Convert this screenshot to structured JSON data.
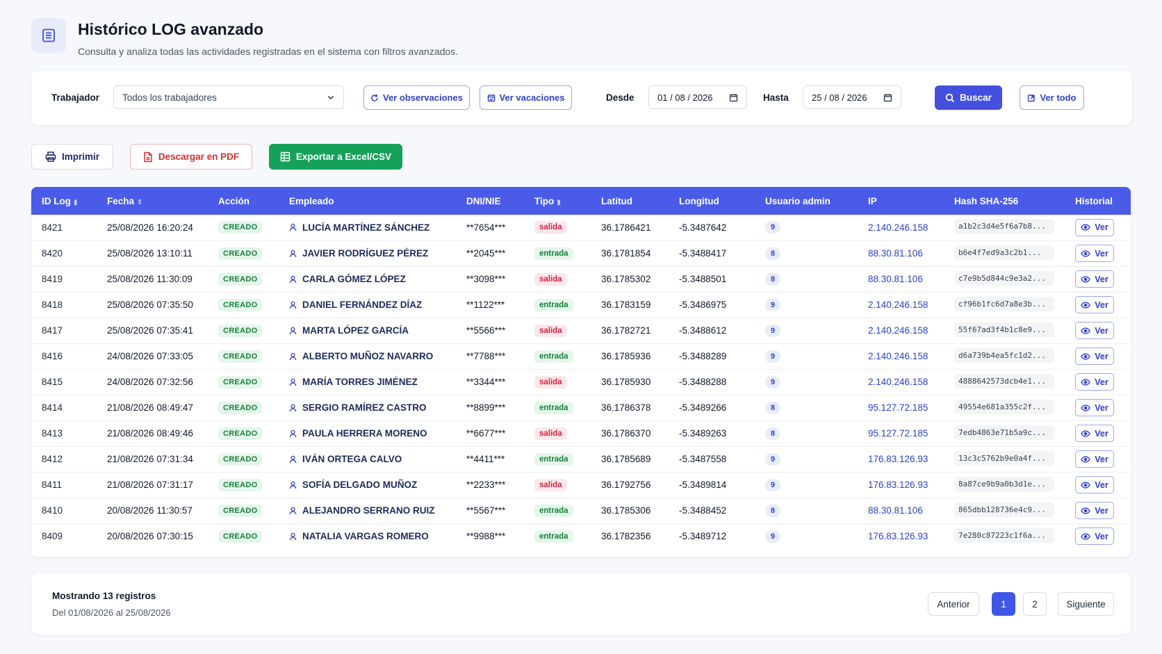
{
  "header": {
    "title": "Histórico LOG avanzado",
    "subtitle": "Consulta y analiza todas las actividades registradas en el sistema con filtros avanzados."
  },
  "filters": {
    "worker_label": "Trabajador",
    "worker_value": "Todos los trabajadores",
    "ver_observaciones": "Ver observaciones",
    "ver_vacaciones": "Ver vacaciones",
    "desde_label": "Desde",
    "desde_value": "01 / 08 / 2026",
    "hasta_label": "Hasta",
    "hasta_value": "25 / 08 / 2026",
    "buscar": "Buscar",
    "ver_todo": "Ver todo"
  },
  "actions": {
    "imprimir": "Imprimir",
    "pdf": "Descargar en PDF",
    "excel": "Exportar a Excel/CSV"
  },
  "table": {
    "columns": [
      "ID Log",
      "Fecha",
      "Acción",
      "Empleado",
      "DNI/NIE",
      "Tipo",
      "Latitud",
      "Longitud",
      "Usuario admin",
      "IP",
      "Hash SHA-256",
      "Historial"
    ],
    "ver_label": "Ver",
    "rows": [
      {
        "id": "8421",
        "fecha": "25/08/2026 16:20:24",
        "accion": "CREADO",
        "empleado": "LUCÍA MARTÍNEZ SÁNCHEZ",
        "dni": "**7654***",
        "tipo": "salida",
        "lat": "36.1786421",
        "lon": "-5.3487642",
        "admin": "9",
        "ip": "2.140.246.158",
        "hash": "a1b2c3d4e5f6a7b8..."
      },
      {
        "id": "8420",
        "fecha": "25/08/2026 13:10:11",
        "accion": "CREADO",
        "empleado": "JAVIER RODRÍGUEZ PÉREZ",
        "dni": "**2045***",
        "tipo": "entrada",
        "lat": "36.1781854",
        "lon": "-5.3488417",
        "admin": "8",
        "ip": "88.30.81.106",
        "hash": "b6e4f7ed9a3c2b1..."
      },
      {
        "id": "8419",
        "fecha": "25/08/2026 11:30:09",
        "accion": "CREADO",
        "empleado": "CARLA GÓMEZ LÓPEZ",
        "dni": "**3098***",
        "tipo": "salida",
        "lat": "36.1785302",
        "lon": "-5.3488501",
        "admin": "8",
        "ip": "88.30.81.106",
        "hash": "c7e9b5d844c9e3a2..."
      },
      {
        "id": "8418",
        "fecha": "25/08/2026 07:35:50",
        "accion": "CREADO",
        "empleado": "DANIEL FERNÁNDEZ DÍAZ",
        "dni": "**1122***",
        "tipo": "entrada",
        "lat": "36.1783159",
        "lon": "-5.3486975",
        "admin": "9",
        "ip": "2.140.246.158",
        "hash": "cf96b1fc6d7a8e3b..."
      },
      {
        "id": "8417",
        "fecha": "25/08/2026 07:35:41",
        "accion": "CREADO",
        "empleado": "MARTA LÓPEZ GARCÍA",
        "dni": "**5566***",
        "tipo": "salida",
        "lat": "36.1782721",
        "lon": "-5.3488612",
        "admin": "9",
        "ip": "2.140.246.158",
        "hash": "55f67ad3f4b1c8e9..."
      },
      {
        "id": "8416",
        "fecha": "24/08/2026 07:33:05",
        "accion": "CREADO",
        "empleado": "ALBERTO MUÑOZ NAVARRO",
        "dni": "**7788***",
        "tipo": "entrada",
        "lat": "36.1785936",
        "lon": "-5.3488289",
        "admin": "9",
        "ip": "2.140.246.158",
        "hash": "d6a739b4ea5fc1d2..."
      },
      {
        "id": "8415",
        "fecha": "24/08/2026 07:32:56",
        "accion": "CREADO",
        "empleado": "MARÍA TORRES JIMÉNEZ",
        "dni": "**3344***",
        "tipo": "salida",
        "lat": "36.1785930",
        "lon": "-5.3488288",
        "admin": "9",
        "ip": "2.140.246.158",
        "hash": "4888642573dcb4e1..."
      },
      {
        "id": "8414",
        "fecha": "21/08/2026 08:49:47",
        "accion": "CREADO",
        "empleado": "SERGIO RAMÍREZ CASTRO",
        "dni": "**8899***",
        "tipo": "entrada",
        "lat": "36.1786378",
        "lon": "-5.3489266",
        "admin": "8",
        "ip": "95.127.72.185",
        "hash": "49554e681a355c2f..."
      },
      {
        "id": "8413",
        "fecha": "21/08/2026 08:49:46",
        "accion": "CREADO",
        "empleado": "PAULA HERRERA MORENO",
        "dni": "**6677***",
        "tipo": "salida",
        "lat": "36.1786370",
        "lon": "-5.3489263",
        "admin": "8",
        "ip": "95.127.72.185",
        "hash": "7edb4863e71b5a9c..."
      },
      {
        "id": "8412",
        "fecha": "21/08/2026 07:31:34",
        "accion": "CREADO",
        "empleado": "IVÁN ORTEGA CALVO",
        "dni": "**4411***",
        "tipo": "entrada",
        "lat": "36.1785689",
        "lon": "-5.3487558",
        "admin": "9",
        "ip": "176.83.126.93",
        "hash": "13c3c5762b9e0a4f..."
      },
      {
        "id": "8411",
        "fecha": "21/08/2026 07:31:17",
        "accion": "CREADO",
        "empleado": "SOFÍA DELGADO MUÑOZ",
        "dni": "**2233***",
        "tipo": "salida",
        "lat": "36.1792756",
        "lon": "-5.3489814",
        "admin": "9",
        "ip": "176.83.126.93",
        "hash": "8a87ce9b9a0b3d1e..."
      },
      {
        "id": "8410",
        "fecha": "20/08/2026 11:30:57",
        "accion": "CREADO",
        "empleado": "ALEJANDRO SERRANO RUIZ",
        "dni": "**5567***",
        "tipo": "entrada",
        "lat": "36.1785306",
        "lon": "-5.3488452",
        "admin": "8",
        "ip": "88.30.81.106",
        "hash": "865dbb128736e4c9..."
      },
      {
        "id": "8409",
        "fecha": "20/08/2026 07:30:15",
        "accion": "CREADO",
        "empleado": "NATALIA VARGAS ROMERO",
        "dni": "**9988***",
        "tipo": "entrada",
        "lat": "36.1782356",
        "lon": "-5.3489712",
        "admin": "9",
        "ip": "176.83.126.93",
        "hash": "7e280c87223c1f6a..."
      }
    ]
  },
  "footer": {
    "count": "Mostrando 13 registros",
    "range": "Del 01/08/2026 al 25/08/2026",
    "anterior": "Anterior",
    "page1": "1",
    "page2": "2",
    "siguiente": "Siguiente"
  },
  "icons": {
    "header": "document-list-icon",
    "calendar": "calendar-icon",
    "search": "search-icon",
    "printer": "printer-icon",
    "pdf": "pdf-file-icon",
    "excel": "spreadsheet-icon",
    "user": "user-icon",
    "eye": "eye-icon"
  },
  "colors": {
    "primary": "#4450dd",
    "table_header": "#4a5be8",
    "success": "#16a15a",
    "danger": "#d92d2d"
  }
}
